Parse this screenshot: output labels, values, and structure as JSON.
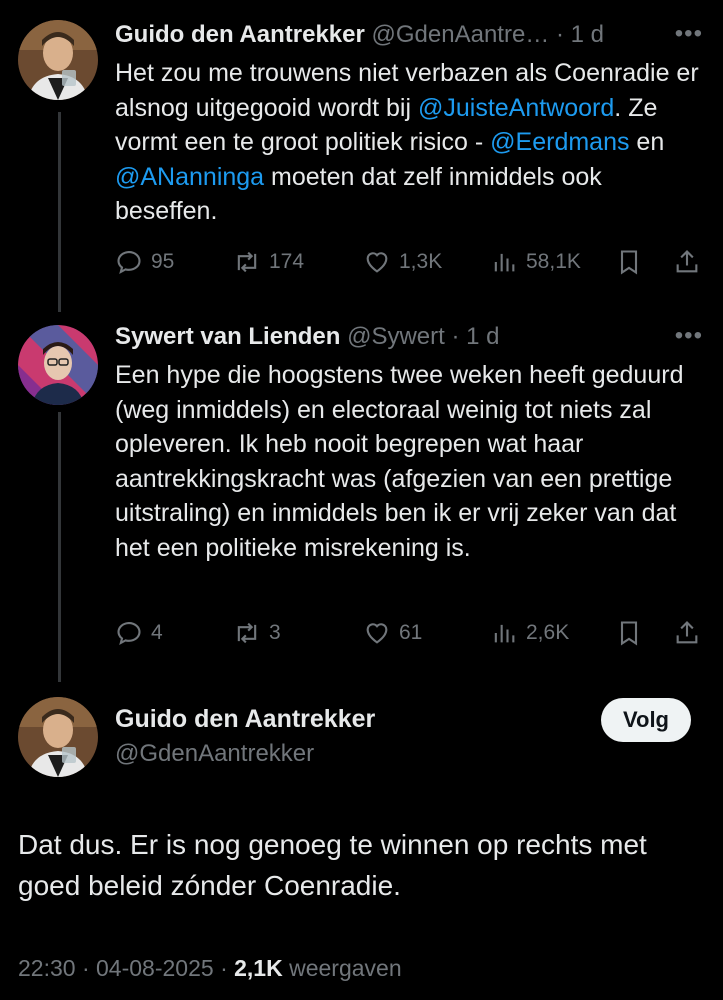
{
  "tweets": [
    {
      "name": "Guido den Aantrekker",
      "handle": "@GdenAantre…",
      "separator": "·",
      "time": "1 d",
      "more": "•••",
      "text_parts": [
        {
          "t": "Het zou me trouwens niet verbazen als Coenradie er alsnog uitgegooid wordt bij "
        },
        {
          "t": "@JuisteAntwoord",
          "mention": true
        },
        {
          "t": ". Ze vormt een te groot politiek risico - "
        },
        {
          "t": "@Eerdmans",
          "mention": true
        },
        {
          "t": " en "
        },
        {
          "t": "@ANanninga",
          "mention": true
        },
        {
          "t": " moeten dat zelf inmiddels ook beseffen."
        }
      ],
      "replies": "95",
      "reposts": "174",
      "likes": "1,3K",
      "views": "58,1K"
    },
    {
      "name": "Sywert van Lienden",
      "handle": "@Sywert",
      "separator": "·",
      "time": "1 d",
      "more": "•••",
      "text_parts": [
        {
          "t": "Een hype die hoogstens twee weken heeft geduurd (weg inmiddels) en electoraal weinig tot niets zal opleveren. Ik heb nooit begrepen wat haar aantrekkingskracht was (afgezien van een prettige uitstraling) en inmiddels ben ik er vrij zeker van dat het een politieke misrekening is."
        }
      ],
      "replies": "4",
      "reposts": "3",
      "likes": "61",
      "views": "2,6K"
    }
  ],
  "main": {
    "name": "Guido den Aantrekker",
    "handle": "@GdenAantrekker",
    "follow_label": "Volg",
    "text": "Dat dus. Er is nog genoeg te winnen op rechts met goed beleid zónder Coenradie.",
    "time": "22:30",
    "sep1": "·",
    "date": "04-08-2025",
    "sep2": "·",
    "views_count": "2,1K",
    "views_label": "weergaven"
  },
  "icons": {
    "reply": "reply-icon",
    "repost": "repost-icon",
    "like": "heart-icon",
    "views": "views-icon",
    "bookmark": "bookmark-icon",
    "share": "share-icon"
  },
  "colors": {
    "background": "#000000",
    "text": "#e7e9ea",
    "muted": "#71767b",
    "mention": "#1d9bf0",
    "follow_bg": "#eff3f4"
  }
}
